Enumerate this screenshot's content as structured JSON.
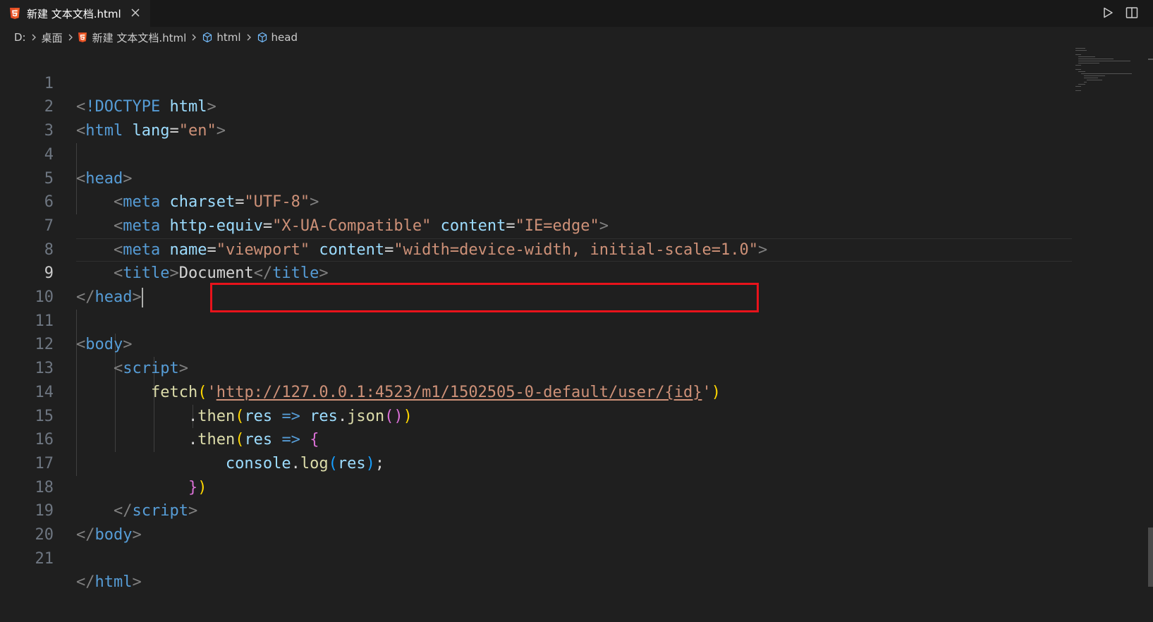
{
  "tab": {
    "label": "新建 文本文档.html",
    "icon": "html5-icon",
    "close_icon": "close-icon"
  },
  "top_actions": [
    {
      "name": "run-icon"
    },
    {
      "name": "split-editor-icon"
    }
  ],
  "breadcrumb": {
    "items": [
      "D:",
      "桌面",
      "新建 文本文档.html",
      "html",
      "head"
    ]
  },
  "editor": {
    "active_line": 9,
    "line_numbers": [
      "1",
      "2",
      "3",
      "4",
      "5",
      "6",
      "7",
      "8",
      "9",
      "10",
      "11",
      "12",
      "13",
      "14",
      "15",
      "16",
      "17",
      "18",
      "19",
      "20",
      "21"
    ],
    "tokens": {
      "l1": [
        "<",
        "!DOCTYPE",
        " ",
        "html",
        ">"
      ],
      "l2": [
        "<",
        "html",
        " ",
        "lang",
        "=",
        "\"en\"",
        ">"
      ],
      "l4": [
        "<",
        "head",
        ">"
      ],
      "l5": [
        "    ",
        "<",
        "meta",
        " ",
        "charset",
        "=",
        "\"UTF-8\"",
        ">"
      ],
      "l6": [
        "    ",
        "<",
        "meta",
        " ",
        "http-equiv",
        "=",
        "\"X-UA-Compatible\"",
        " ",
        "content",
        "=",
        "\"IE=edge\"",
        ">"
      ],
      "l7": [
        "    ",
        "<",
        "meta",
        " ",
        "name",
        "=",
        "\"viewport\"",
        " ",
        "content",
        "=",
        "\"width=device-width, initial-scale=1.0\"",
        ">"
      ],
      "l8": [
        "    ",
        "<",
        "title",
        ">",
        "Document",
        "</",
        "title",
        ">"
      ],
      "l9": [
        "</",
        "head",
        ">"
      ],
      "l11": [
        "<",
        "body",
        ">"
      ],
      "l12": [
        "    ",
        "<",
        "script",
        ">"
      ],
      "l13": [
        "        ",
        "fetch",
        "(",
        "'",
        "http://127.0.0.1:4523/m1/1502505-0-default/user/{id}",
        "'",
        ")"
      ],
      "l14": [
        "            ",
        ".",
        "then",
        "(",
        "res",
        " ",
        "=>",
        " ",
        "res",
        ".",
        "json",
        "()",
        ")"
      ],
      "l15": [
        "            ",
        ".",
        "then",
        "(",
        "res",
        " ",
        "=>",
        " ",
        "{"
      ],
      "l16": [
        "                ",
        "console",
        ".",
        "log",
        "(",
        "res",
        ")",
        ";"
      ],
      "l17": [
        "            ",
        "}",
        ")"
      ],
      "l18": [
        "    ",
        "</",
        "script",
        ">"
      ],
      "l19": [
        "</",
        "body",
        ">"
      ],
      "l21": [
        "</",
        "html",
        ">"
      ]
    }
  },
  "colors": {
    "background": "#1f1f1f",
    "tag": "#569cd6",
    "attribute": "#9cdcfe",
    "string": "#ce9178",
    "function": "#dcdcaa",
    "highlight_box": "#e8131b"
  }
}
